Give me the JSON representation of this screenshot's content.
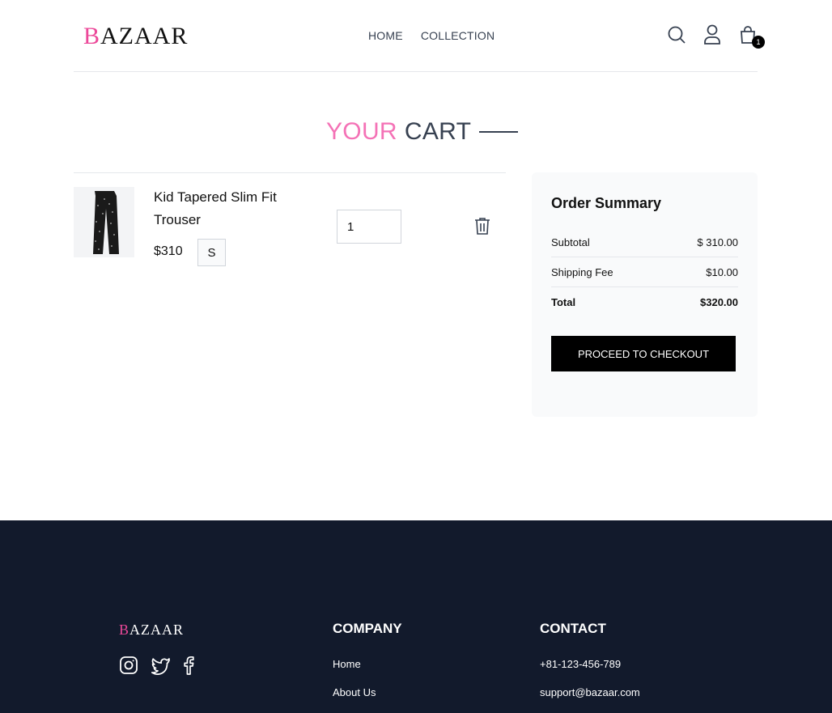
{
  "header": {
    "logo_first": "B",
    "logo_rest": "AZAAR",
    "nav": [
      "HOME",
      "COLLECTION"
    ],
    "cart_count": "1"
  },
  "page": {
    "title_a": "YOUR",
    "title_b": "CART"
  },
  "cart": {
    "items": [
      {
        "name": "Kid Tapered Slim Fit Trouser",
        "price": "$310",
        "size": "S",
        "quantity": "1"
      }
    ]
  },
  "summary": {
    "title": "Order Summary",
    "subtotal_label": "Subtotal",
    "subtotal_value": "$ 310.00",
    "shipping_label": "Shipping Fee",
    "shipping_value": "$10.00",
    "total_label": "Total",
    "total_value": "$320.00",
    "checkout_label": "PROCEED TO CHECKOUT"
  },
  "footer": {
    "logo_first": "B",
    "logo_rest": "AZAAR",
    "company_title": "COMPANY",
    "company_links": [
      "Home",
      "About Us"
    ],
    "contact_title": "CONTACT",
    "phone": "+81-123-456-789",
    "email": "support@bazaar.com"
  },
  "colors": {
    "accent": "#ec4899",
    "footer_bg": "#121a2c"
  },
  "icons": [
    "search-icon",
    "user-icon",
    "shopping-bag-icon",
    "trash-icon",
    "instagram-icon",
    "twitter-icon",
    "facebook-icon"
  ]
}
